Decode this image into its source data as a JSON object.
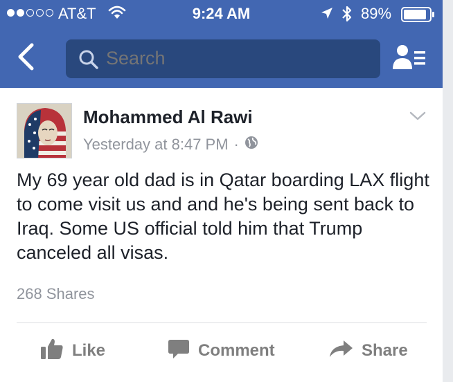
{
  "status_bar": {
    "carrier": "AT&T",
    "time": "9:24 AM",
    "battery_percent": "89%",
    "signal_bars": 2,
    "battery_level": 0.89,
    "icons": [
      "signal-dots-icon",
      "wifi-icon",
      "location-arrow-icon",
      "bluetooth-icon",
      "battery-icon"
    ]
  },
  "nav": {
    "back_icon": "chevron-left-icon",
    "search_placeholder": "Search",
    "right_icon": "friends-list-icon"
  },
  "post": {
    "author": "Mohammed Al Rawi",
    "timestamp": "Yesterday at 8:47 PM",
    "separator": "·",
    "privacy_icon": "globe-icon",
    "text": "My 69 year old dad is in Qatar boarding LAX flight to come visit us and and he's being sent back to Iraq. Some US official told him that Trump canceled all visas.",
    "shares": "268 Shares"
  },
  "actions": {
    "like": "Like",
    "comment": "Comment",
    "share": "Share"
  },
  "colors": {
    "header_blue": "#4267b2",
    "search_box": "#29487d",
    "text_dark": "#1d2129",
    "text_gray": "#90949c",
    "action_gray": "#7f7f7f"
  }
}
